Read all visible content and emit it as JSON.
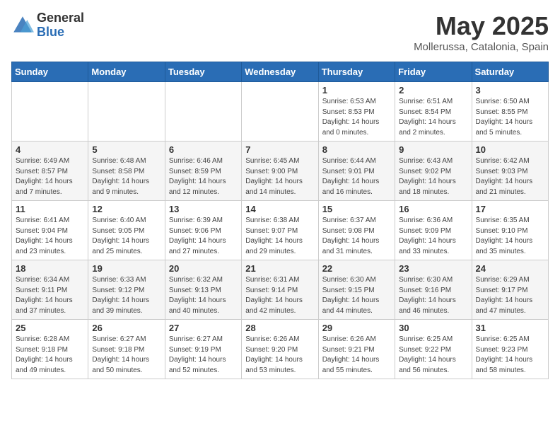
{
  "logo": {
    "general": "General",
    "blue": "Blue"
  },
  "title": "May 2025",
  "location": "Mollerussa, Catalonia, Spain",
  "days_of_week": [
    "Sunday",
    "Monday",
    "Tuesday",
    "Wednesday",
    "Thursday",
    "Friday",
    "Saturday"
  ],
  "weeks": [
    [
      {
        "day": "",
        "info": ""
      },
      {
        "day": "",
        "info": ""
      },
      {
        "day": "",
        "info": ""
      },
      {
        "day": "",
        "info": ""
      },
      {
        "day": "1",
        "info": "Sunrise: 6:53 AM\nSunset: 8:53 PM\nDaylight: 14 hours and 0 minutes."
      },
      {
        "day": "2",
        "info": "Sunrise: 6:51 AM\nSunset: 8:54 PM\nDaylight: 14 hours and 2 minutes."
      },
      {
        "day": "3",
        "info": "Sunrise: 6:50 AM\nSunset: 8:55 PM\nDaylight: 14 hours and 5 minutes."
      }
    ],
    [
      {
        "day": "4",
        "info": "Sunrise: 6:49 AM\nSunset: 8:57 PM\nDaylight: 14 hours and 7 minutes."
      },
      {
        "day": "5",
        "info": "Sunrise: 6:48 AM\nSunset: 8:58 PM\nDaylight: 14 hours and 9 minutes."
      },
      {
        "day": "6",
        "info": "Sunrise: 6:46 AM\nSunset: 8:59 PM\nDaylight: 14 hours and 12 minutes."
      },
      {
        "day": "7",
        "info": "Sunrise: 6:45 AM\nSunset: 9:00 PM\nDaylight: 14 hours and 14 minutes."
      },
      {
        "day": "8",
        "info": "Sunrise: 6:44 AM\nSunset: 9:01 PM\nDaylight: 14 hours and 16 minutes."
      },
      {
        "day": "9",
        "info": "Sunrise: 6:43 AM\nSunset: 9:02 PM\nDaylight: 14 hours and 18 minutes."
      },
      {
        "day": "10",
        "info": "Sunrise: 6:42 AM\nSunset: 9:03 PM\nDaylight: 14 hours and 21 minutes."
      }
    ],
    [
      {
        "day": "11",
        "info": "Sunrise: 6:41 AM\nSunset: 9:04 PM\nDaylight: 14 hours and 23 minutes."
      },
      {
        "day": "12",
        "info": "Sunrise: 6:40 AM\nSunset: 9:05 PM\nDaylight: 14 hours and 25 minutes."
      },
      {
        "day": "13",
        "info": "Sunrise: 6:39 AM\nSunset: 9:06 PM\nDaylight: 14 hours and 27 minutes."
      },
      {
        "day": "14",
        "info": "Sunrise: 6:38 AM\nSunset: 9:07 PM\nDaylight: 14 hours and 29 minutes."
      },
      {
        "day": "15",
        "info": "Sunrise: 6:37 AM\nSunset: 9:08 PM\nDaylight: 14 hours and 31 minutes."
      },
      {
        "day": "16",
        "info": "Sunrise: 6:36 AM\nSunset: 9:09 PM\nDaylight: 14 hours and 33 minutes."
      },
      {
        "day": "17",
        "info": "Sunrise: 6:35 AM\nSunset: 9:10 PM\nDaylight: 14 hours and 35 minutes."
      }
    ],
    [
      {
        "day": "18",
        "info": "Sunrise: 6:34 AM\nSunset: 9:11 PM\nDaylight: 14 hours and 37 minutes."
      },
      {
        "day": "19",
        "info": "Sunrise: 6:33 AM\nSunset: 9:12 PM\nDaylight: 14 hours and 39 minutes."
      },
      {
        "day": "20",
        "info": "Sunrise: 6:32 AM\nSunset: 9:13 PM\nDaylight: 14 hours and 40 minutes."
      },
      {
        "day": "21",
        "info": "Sunrise: 6:31 AM\nSunset: 9:14 PM\nDaylight: 14 hours and 42 minutes."
      },
      {
        "day": "22",
        "info": "Sunrise: 6:30 AM\nSunset: 9:15 PM\nDaylight: 14 hours and 44 minutes."
      },
      {
        "day": "23",
        "info": "Sunrise: 6:30 AM\nSunset: 9:16 PM\nDaylight: 14 hours and 46 minutes."
      },
      {
        "day": "24",
        "info": "Sunrise: 6:29 AM\nSunset: 9:17 PM\nDaylight: 14 hours and 47 minutes."
      }
    ],
    [
      {
        "day": "25",
        "info": "Sunrise: 6:28 AM\nSunset: 9:18 PM\nDaylight: 14 hours and 49 minutes."
      },
      {
        "day": "26",
        "info": "Sunrise: 6:27 AM\nSunset: 9:18 PM\nDaylight: 14 hours and 50 minutes."
      },
      {
        "day": "27",
        "info": "Sunrise: 6:27 AM\nSunset: 9:19 PM\nDaylight: 14 hours and 52 minutes."
      },
      {
        "day": "28",
        "info": "Sunrise: 6:26 AM\nSunset: 9:20 PM\nDaylight: 14 hours and 53 minutes."
      },
      {
        "day": "29",
        "info": "Sunrise: 6:26 AM\nSunset: 9:21 PM\nDaylight: 14 hours and 55 minutes."
      },
      {
        "day": "30",
        "info": "Sunrise: 6:25 AM\nSunset: 9:22 PM\nDaylight: 14 hours and 56 minutes."
      },
      {
        "day": "31",
        "info": "Sunrise: 6:25 AM\nSunset: 9:23 PM\nDaylight: 14 hours and 58 minutes."
      }
    ]
  ]
}
